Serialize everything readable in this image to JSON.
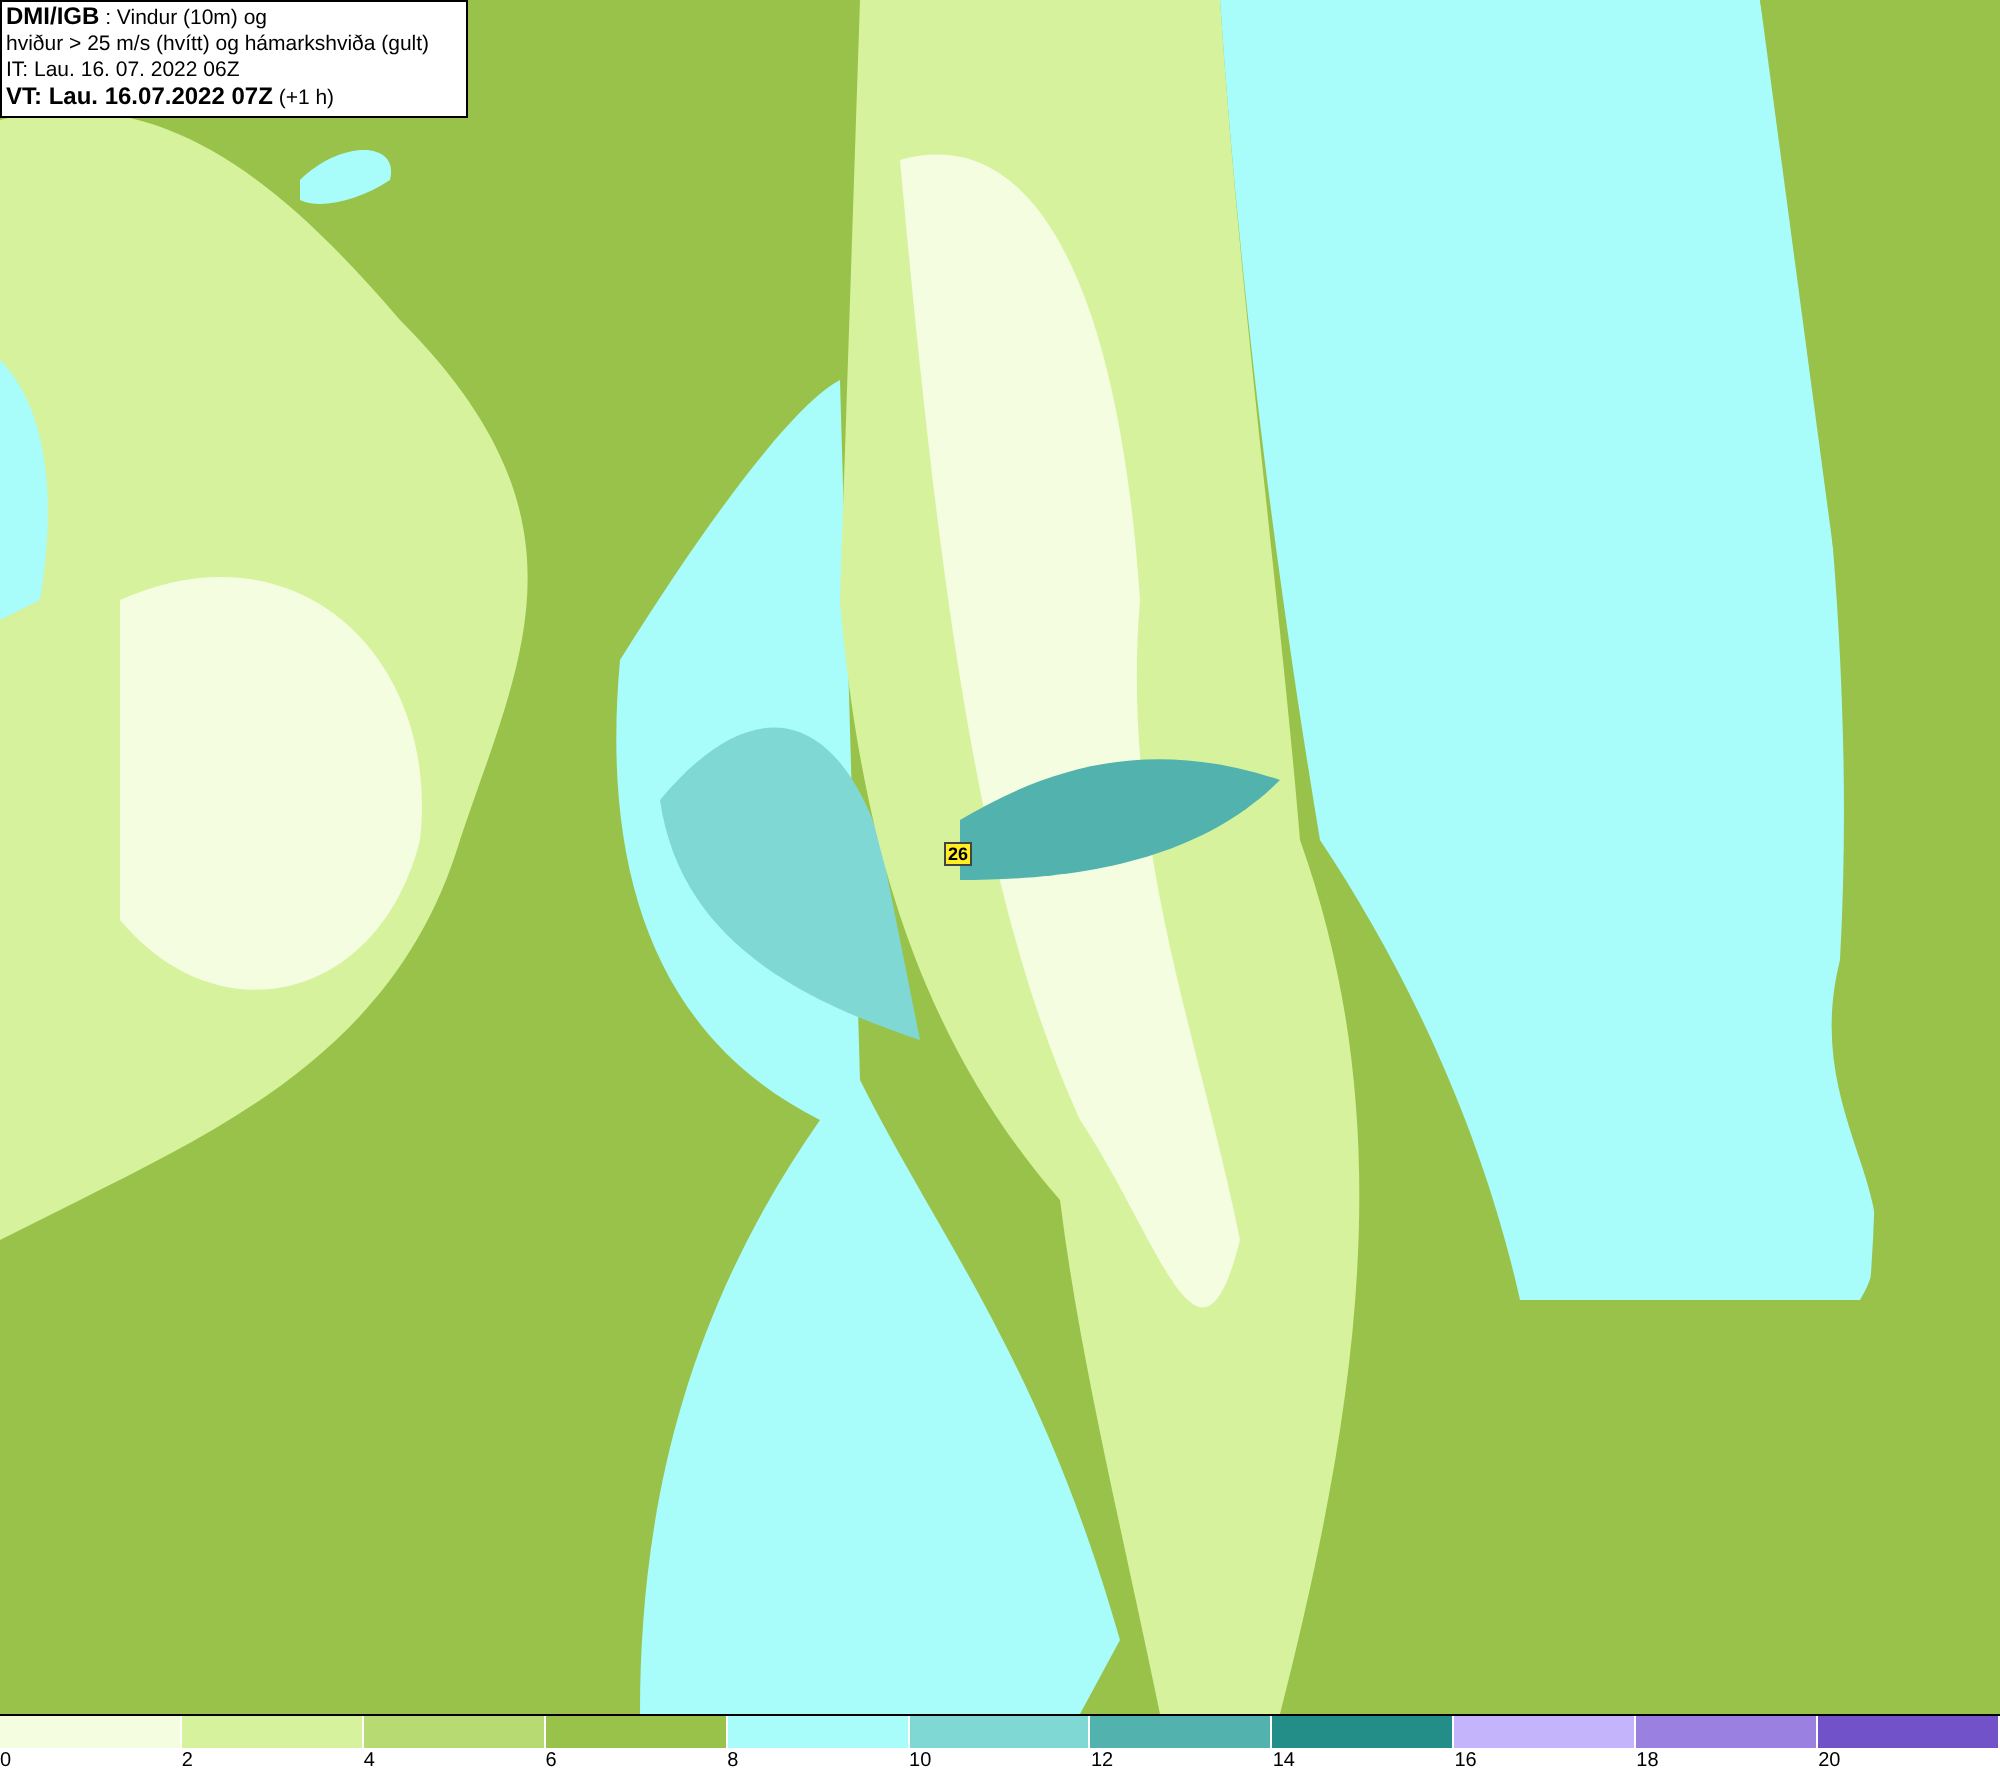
{
  "info_box": {
    "lines": [
      "**DMI/IGB** : Vindur (10m) og",
      "hviður > 25 m/s (hvítt) og hámarkshviða (gult)",
      "IT: Lau. 16. 07. 2022 06Z",
      "**VT: Lau. 16.07.2022 07Z** (+1 h)"
    ]
  },
  "map": {
    "gust_marker": "26"
  },
  "legend": {
    "segments": [
      {
        "label": "0",
        "color": "#f4fde0"
      },
      {
        "label": "2",
        "color": "#d7f29c"
      },
      {
        "label": "4",
        "color": "#b7db72"
      },
      {
        "label": "6",
        "color": "#99c24a"
      },
      {
        "label": "8",
        "color": "#a8fcfa"
      },
      {
        "label": "10",
        "color": "#7fd8d4"
      },
      {
        "label": "12",
        "color": "#52b2ae"
      },
      {
        "label": "14",
        "color": "#238e88"
      },
      {
        "label": "16",
        "color": "#c4b4fc"
      },
      {
        "label": "18",
        "color": "#9a80e0"
      },
      {
        "label": "20",
        "color": "#7252c8"
      }
    ]
  }
}
